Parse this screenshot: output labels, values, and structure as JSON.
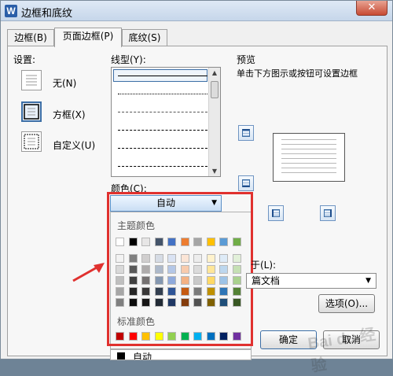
{
  "window": {
    "title": "边框和底纹",
    "app_icon": "W",
    "close_glyph": "✕"
  },
  "tabs": [
    {
      "label": "边框(B)"
    },
    {
      "label": "页面边框(P)"
    },
    {
      "label": "底纹(S)"
    }
  ],
  "settings": {
    "heading": "设置:",
    "options": [
      {
        "label": "无(N)"
      },
      {
        "label": "方框(X)"
      },
      {
        "label": "自定义(U)"
      }
    ]
  },
  "line_style": {
    "label": "线型(Y):",
    "styles": [
      "solid",
      "dotted",
      "dashed-short",
      "dashed",
      "dash-dot",
      "dash-long"
    ]
  },
  "color": {
    "label": "颜色(C):",
    "selected": "自动",
    "theme_heading": "主题颜色",
    "standard_heading": "标准颜色",
    "auto_option": "自动",
    "theme_row": [
      "#ffffff",
      "#000000",
      "#e7e6e6",
      "#44546a",
      "#4472c4",
      "#ed7d31",
      "#a5a5a5",
      "#ffc000",
      "#5b9bd5",
      "#70ad47"
    ],
    "theme_shades": [
      [
        "#f2f2f2",
        "#7f7f7f",
        "#d0cece",
        "#d6dce5",
        "#dae3f3",
        "#fbe5d6",
        "#ededed",
        "#fff2cc",
        "#deebf7",
        "#e2f0d9"
      ],
      [
        "#d9d9d9",
        "#595959",
        "#aeabab",
        "#adb9ca",
        "#b4c7e7",
        "#f8cbad",
        "#dbdbdb",
        "#ffe699",
        "#bdd7ee",
        "#c5e0b4"
      ],
      [
        "#bfbfbf",
        "#404040",
        "#757171",
        "#8497b0",
        "#8faadc",
        "#f4b183",
        "#c9c9c9",
        "#ffd966",
        "#9dc3e6",
        "#a9d18e"
      ],
      [
        "#a6a6a6",
        "#262626",
        "#3a3838",
        "#333f50",
        "#2f5597",
        "#c55a11",
        "#7b7b7b",
        "#bf9000",
        "#2e75b6",
        "#538135"
      ],
      [
        "#7f7f7f",
        "#0d0d0d",
        "#171616",
        "#222a35",
        "#203864",
        "#843c0c",
        "#525252",
        "#7f6000",
        "#1f4e79",
        "#385723"
      ]
    ],
    "standard_row": [
      "#c00000",
      "#ff0000",
      "#ffc000",
      "#ffff00",
      "#92d050",
      "#00b050",
      "#00b0f0",
      "#0070c0",
      "#002060",
      "#7030a0"
    ]
  },
  "preview": {
    "heading": "预览",
    "hint": "单击下方图示或按钮可设置边框",
    "apply_label": "应用于(L):",
    "apply_label_visible": "于(L):",
    "apply_value": "整篇文档",
    "apply_value_visible": "篇文档"
  },
  "buttons": {
    "options": "选项(O)...",
    "ok": "确定",
    "cancel": "取消"
  },
  "watermark": "Bai du 经验",
  "colors": {
    "highlight": "#e0312f",
    "accent": "#3c6ea5"
  }
}
